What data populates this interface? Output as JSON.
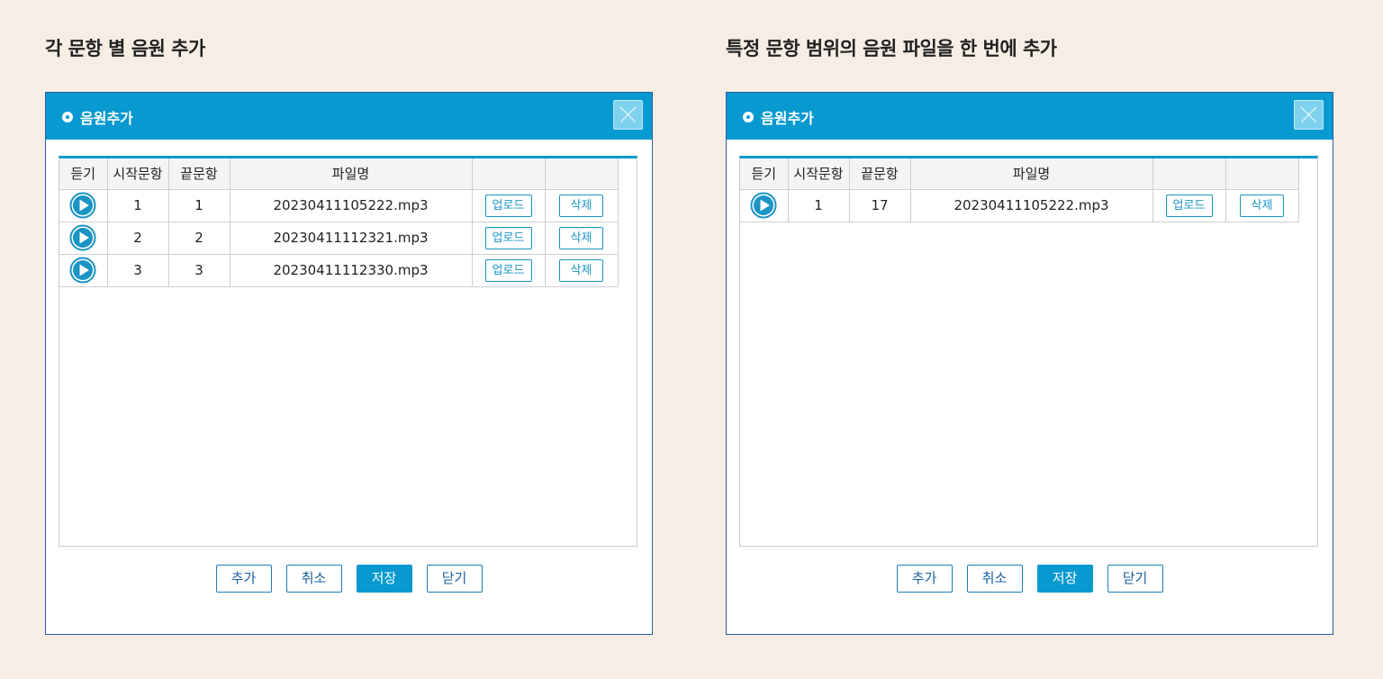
{
  "colors": {
    "page_background": "#f6eee4",
    "header_blue": "#0799d0",
    "dialog_border": "#2b5aa6",
    "button_outline": "#1a94c4"
  },
  "panels": [
    {
      "section_title": "각 문항 별 음원 추가",
      "dialog": {
        "title": "음원추가",
        "close_icon": "close-x-icon",
        "columns": [
          "듣기",
          "시작문항",
          "끝문항",
          "파일명",
          "",
          ""
        ],
        "rows": [
          {
            "start": "1",
            "end": "1",
            "file": "20230411105222.mp3",
            "upload": "업로드",
            "delete": "삭제"
          },
          {
            "start": "2",
            "end": "2",
            "file": "20230411112321.mp3",
            "upload": "업로드",
            "delete": "삭제"
          },
          {
            "start": "3",
            "end": "3",
            "file": "20230411112330.mp3",
            "upload": "업로드",
            "delete": "삭제"
          }
        ],
        "buttons": {
          "add": "추가",
          "cancel": "취소",
          "save": "저장",
          "close": "닫기"
        }
      }
    },
    {
      "section_title": "특정 문항 범위의 음원 파일을 한 번에 추가",
      "dialog": {
        "title": "음원추가",
        "close_icon": "close-x-icon",
        "columns": [
          "듣기",
          "시작문항",
          "끝문항",
          "파일명",
          "",
          ""
        ],
        "rows": [
          {
            "start": "1",
            "end": "17",
            "file": "20230411105222.mp3",
            "upload": "업로드",
            "delete": "삭제"
          }
        ],
        "buttons": {
          "add": "추가",
          "cancel": "취소",
          "save": "저장",
          "close": "닫기"
        }
      }
    }
  ]
}
